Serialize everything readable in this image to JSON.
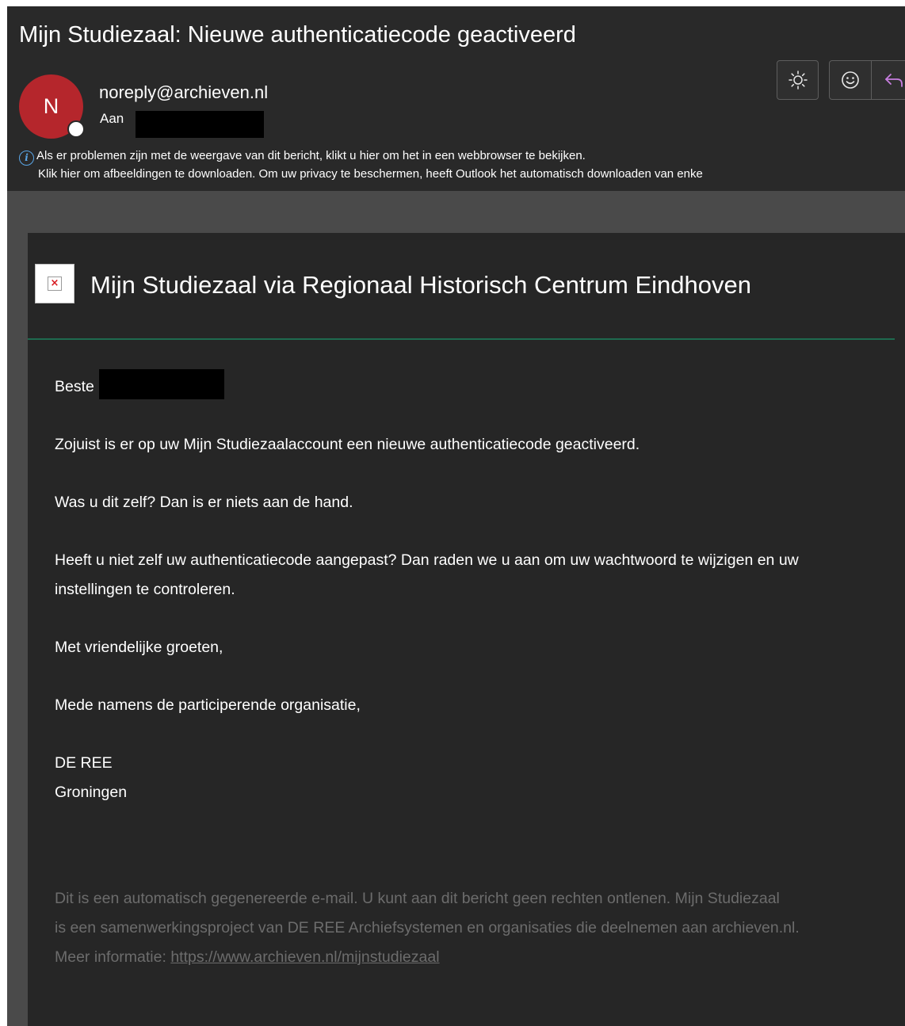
{
  "email": {
    "subject": "Mijn Studiezaal: Nieuwe authenticatiecode geactiveerd",
    "avatar_initial": "N",
    "sender": "noreply@archieven.nl",
    "to_label": "Aan",
    "info_line_1": "Als er problemen zijn met de weergave van dit bericht, klikt u hier om het in een webbrowser te bekijken.",
    "info_line_2": "Klik hier om afbeeldingen te downloaden. Om uw privacy te beschermen, heeft Outlook het automatisch downloaden van enke",
    "toolbar": {
      "theme_icon": "sun-icon",
      "emoji_icon": "smiley-icon",
      "reply_icon": "reply-arrow-icon"
    }
  },
  "message": {
    "header_title": "Mijn Studiezaal via Regionaal Historisch Centrum Eindhoven",
    "greeting": "Beste",
    "paragraph_1": "Zojuist is er op uw Mijn Studiezaalaccount een nieuwe authenticatiecode geactiveerd.",
    "paragraph_2": "Was u dit zelf? Dan is er niets aan de hand.",
    "paragraph_3_line_1": "Heeft u niet zelf uw authenticatiecode aangepast? Dan raden we u aan om uw wachtwoord te wijzigen en uw",
    "paragraph_3_line_2": "instellingen te controleren.",
    "closing": "Met vriendelijke groeten,",
    "on_behalf": "Mede namens de participerende organisatie,",
    "org_name": "DE REE",
    "org_city": "Groningen",
    "footer_line_1": "Dit is een automatisch gegenereerde e-mail. U kunt aan dit bericht geen rechten ontlenen. Mijn Studiezaal",
    "footer_line_2": "is een samenwerkingsproject van DE REE Archiefsystemen en organisaties die deelnemen aan archieven.nl.",
    "footer_more_label": "Meer informatie: ",
    "footer_link": "https://www.archieven.nl/mijnstudiezaal"
  },
  "colors": {
    "avatar": "#b5262c",
    "header_rule": "#1e6a4f",
    "footer_text": "#6c6c6c",
    "info_icon": "#5aa7e8",
    "reply_icon": "#c87ee0"
  }
}
